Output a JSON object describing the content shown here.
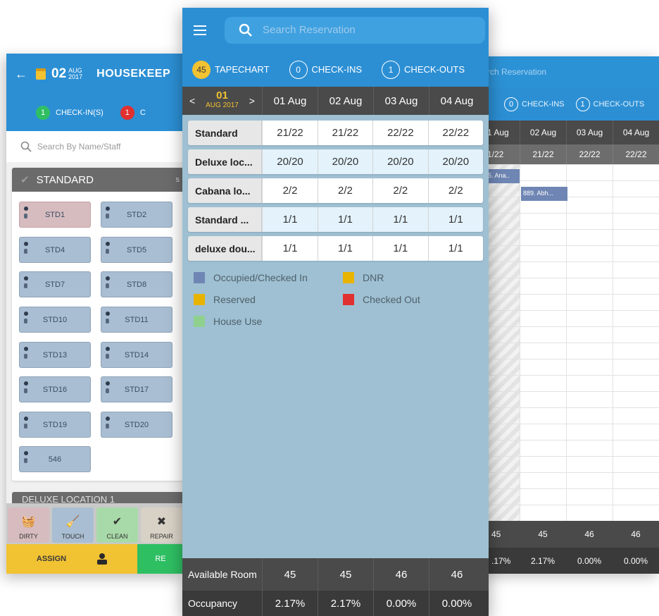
{
  "right_screen": {
    "search_placeholder": "rch Reservation",
    "tabs": [
      {
        "count": "0",
        "label": "CHECK-INS"
      },
      {
        "count": "1",
        "label": "CHECK-OUTS"
      }
    ],
    "date_headers": [
      "1 Aug",
      "02 Aug",
      "03 Aug",
      "04 Aug"
    ],
    "availability": [
      "1/22",
      "21/22",
      "22/22",
      "22/22"
    ],
    "bookings": [
      "5. Ana..",
      "889. Abh..."
    ],
    "footer_values": [
      "45",
      "45",
      "46",
      "46"
    ],
    "footer_pcts": [
      ".17%",
      "2.17%",
      "0.00%",
      "0.00%"
    ]
  },
  "left_screen": {
    "day": "02",
    "month": "AUG",
    "year": "2017",
    "title": "HOUSEKEEP",
    "checkins": {
      "count": "1",
      "label": "CHECK-IN(S)"
    },
    "checkouts": {
      "count": "1",
      "label": "C"
    },
    "search_placeholder": "Search By Name/Staff",
    "section_title": "STANDARD",
    "section_hint": "s",
    "rooms": [
      "STD1",
      "STD2",
      "STD4",
      "STD5",
      "STD7",
      "STD8",
      "STD10",
      "STD11",
      "STD13",
      "STD14",
      "STD16",
      "STD17",
      "STD19",
      "STD20",
      "546"
    ],
    "second_section": "DELUXE LOCATION 1",
    "actions": [
      {
        "icon": "dirty-icon",
        "glyph": "🧺",
        "label": "DIRTY"
      },
      {
        "icon": "touch-icon",
        "glyph": "🧹",
        "label": "TOUCH"
      },
      {
        "icon": "clean-icon",
        "glyph": "✔",
        "label": "CLEAN"
      },
      {
        "icon": "repair-icon",
        "glyph": "✖",
        "label": "REPAIR"
      }
    ],
    "assign_label": "ASSIGN",
    "release_label": "RE"
  },
  "center_screen": {
    "search_placeholder": "Search Reservation",
    "tabs": [
      {
        "count": "45",
        "label": "TAPECHART"
      },
      {
        "count": "0",
        "label": "CHECK-INS"
      },
      {
        "count": "1",
        "label": "CHECK-OUTS"
      }
    ],
    "nav_day": "01",
    "nav_month_year": "AUG 2017",
    "date_headers": [
      "01 Aug",
      "02 Aug",
      "03 Aug",
      "04 Aug"
    ],
    "room_types": [
      {
        "name": "Standard",
        "values": [
          "21/22",
          "21/22",
          "22/22",
          "22/22"
        ]
      },
      {
        "name": "Deluxe loc...",
        "values": [
          "20/20",
          "20/20",
          "20/20",
          "20/20"
        ]
      },
      {
        "name": "Cabana lo...",
        "values": [
          "2/2",
          "2/2",
          "2/2",
          "2/2"
        ]
      },
      {
        "name": "Standard ...",
        "values": [
          "1/1",
          "1/1",
          "1/1",
          "1/1"
        ]
      },
      {
        "name": "deluxe dou...",
        "values": [
          "1/1",
          "1/1",
          "1/1",
          "1/1"
        ]
      }
    ],
    "legend": [
      {
        "label": "Occupied/Checked In",
        "color": "#6f86b4"
      },
      {
        "label": "DNR",
        "color": "#e8b400"
      },
      {
        "label": "Reserved",
        "color": "#e8b400"
      },
      {
        "label": "Checked Out",
        "color": "#e03030"
      },
      {
        "label": "House Use",
        "color": "#8fd08f"
      }
    ],
    "available_room_label": "Available Room",
    "available_room_values": [
      "45",
      "45",
      "46",
      "46"
    ],
    "occupancy_label": "Occupancy",
    "occupancy_values": [
      "2.17%",
      "2.17%",
      "0.00%",
      "0.00%"
    ]
  }
}
